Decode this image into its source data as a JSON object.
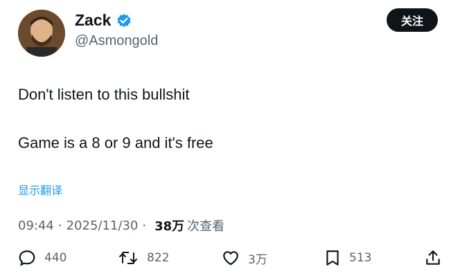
{
  "author": {
    "display_name": "Zack",
    "handle": "@Asmongold",
    "verified_color": "#1d9bf0"
  },
  "follow_label": "关注",
  "tweet": {
    "line1": "Don't listen to this bullshit",
    "line2": "Game is a 8 or 9 and it's free"
  },
  "translate_label": "显示翻译",
  "meta": {
    "time": "09:44",
    "date": "2025/11/30",
    "views_count": "38万",
    "views_label": "次查看"
  },
  "actions": {
    "replies": "440",
    "retweets": "822",
    "likes": "3万",
    "bookmarks": "513"
  },
  "icons": [
    "reply-icon",
    "retweet-icon",
    "like-icon",
    "bookmark-icon",
    "share-icon",
    "verified-badge-icon"
  ]
}
